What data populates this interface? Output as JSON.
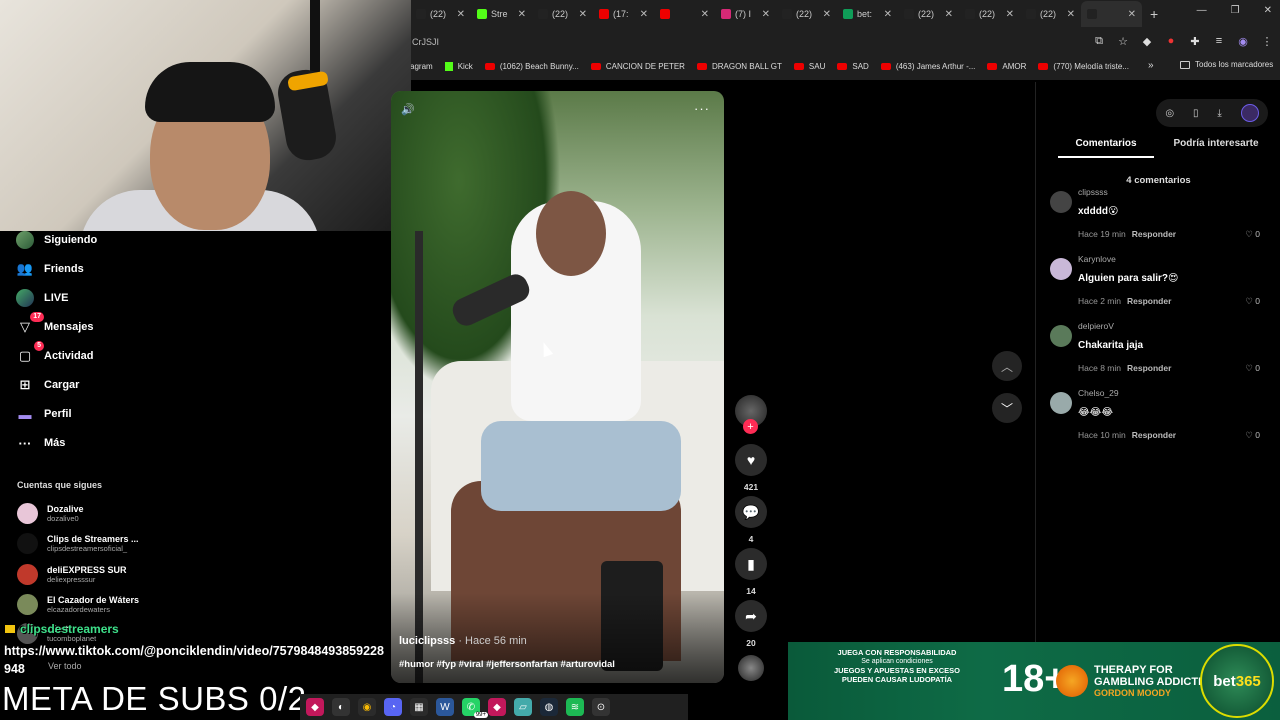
{
  "browser": {
    "tabs": [
      {
        "label": "(22)",
        "icon": "tiktok-icon",
        "color": "#222"
      },
      {
        "label": "Stre",
        "icon": "kick-icon",
        "color": "#53fc18"
      },
      {
        "label": "(22)",
        "icon": "tiktok-icon",
        "color": "#222"
      },
      {
        "label": "(17:",
        "icon": "youtube-icon",
        "color": "#e00"
      },
      {
        "label": "",
        "icon": "youtube-icon",
        "color": "#e00"
      },
      {
        "label": "(7) I",
        "icon": "instagram-icon",
        "color": "#d62976"
      },
      {
        "label": "(22)",
        "icon": "tiktok-icon",
        "color": "#222"
      },
      {
        "label": "bet:",
        "icon": "sheets-icon",
        "color": "#0f9d58"
      },
      {
        "label": "(22)",
        "icon": "tiktok-icon",
        "color": "#222"
      },
      {
        "label": "(22)",
        "icon": "tiktok-icon",
        "color": "#222"
      },
      {
        "label": "(22)",
        "icon": "tiktok-icon",
        "color": "#222"
      },
      {
        "label": "",
        "icon": "tiktok-icon",
        "color": "#222",
        "active": true
      }
    ],
    "new_tab": "+",
    "address_fragment": "CrJSJI",
    "bookmarks": [
      {
        "label": "agram",
        "icon": "none"
      },
      {
        "label": "Kick",
        "icon": "kick-icon"
      },
      {
        "label": "(1062) Beach Bunny...",
        "icon": "youtube-icon"
      },
      {
        "label": "CANCION DE PETER",
        "icon": "youtube-icon"
      },
      {
        "label": "DRAGON BALL GT",
        "icon": "youtube-icon"
      },
      {
        "label": "SAU",
        "icon": "youtube-icon"
      },
      {
        "label": "SAD",
        "icon": "youtube-icon"
      },
      {
        "label": "(463) James Arthur -...",
        "icon": "youtube-icon"
      },
      {
        "label": "AMOR",
        "icon": "youtube-icon"
      },
      {
        "label": "(770) Melodía triste...",
        "icon": "youtube-icon"
      }
    ],
    "bookmarks_more": "»",
    "all_bookmarks": "Todos los marcadores"
  },
  "sidebar": {
    "nav": [
      {
        "label": "Siguiendo",
        "icon": "following-avatar-icon",
        "badge": ""
      },
      {
        "label": "Friends",
        "icon": "friends-icon",
        "badge": ""
      },
      {
        "label": "LIVE",
        "icon": "live-icon",
        "badge": ""
      },
      {
        "label": "Mensajes",
        "icon": "messages-icon",
        "badge": "17"
      },
      {
        "label": "Actividad",
        "icon": "activity-icon",
        "badge": "5"
      },
      {
        "label": "Cargar",
        "icon": "upload-icon",
        "badge": ""
      },
      {
        "label": "Perfil",
        "icon": "profile-icon",
        "badge": ""
      },
      {
        "label": "Más",
        "icon": "more-icon",
        "badge": ""
      }
    ],
    "following_title": "Cuentas que sigues",
    "accounts": [
      {
        "name": "Dozalive",
        "handle": "dozalive0",
        "color": "#e8c6d8"
      },
      {
        "name": "Clips de Streamers ...",
        "handle": "clipsdestreamersoficial_",
        "color": "#111"
      },
      {
        "name": "deliEXPRESS SUR",
        "handle": "deliexpresssur",
        "color": "#c0392b"
      },
      {
        "name": "El Cazador de Wáters",
        "handle": "elcazadordewaters",
        "color": "#7a8a5a"
      },
      {
        "name": "...hot",
        "handle": "tucomboplanet",
        "color": "#555"
      }
    ],
    "see_all": "Ver todo"
  },
  "overlay": {
    "chat_user": "clipsdestreamers",
    "chat_url": "https://www.tiktok.com/@ponciklendin/video/7579848493859228948",
    "meta_subs": "META DE SUBS 0/2"
  },
  "video": {
    "author": "luciclipsss",
    "time": " · Hace 56 min",
    "tags": "#humor #fyp #viral #jeffersonfarfan #arturovidal",
    "likes": "421",
    "comments": "4",
    "saves": "14",
    "shares": "20",
    "more": "···"
  },
  "comments_panel": {
    "tab_comments": "Comentarios",
    "tab_interest": "Podría interesarte",
    "count": "4 comentarios",
    "reply_label": "Responder",
    "items": [
      {
        "user": "clipssss",
        "text": "xdddd😮",
        "time": "Hace 19 min",
        "likes": "0",
        "color": "#444"
      },
      {
        "user": "Karynlove",
        "text": "Alguien para salir?😍",
        "time": "Hace 2 min",
        "likes": "0",
        "color": "#c9b8d8"
      },
      {
        "user": "delpieroV",
        "text": "Chakarita jaja",
        "time": "Hace 8 min",
        "likes": "0",
        "color": "#5a7a5a"
      },
      {
        "user": "Chelso_29",
        "text": "😂😂😂",
        "time": "Hace 10 min",
        "likes": "0",
        "color": "#9aa"
      }
    ]
  },
  "ad": {
    "resp_line1": "JUEGA CON RESPONSABILIDAD",
    "resp_line2": "Se aplican condiciones",
    "resp_line3": "JUEGOS Y APUESTAS EN EXCESO",
    "resp_line4": "PUEDEN CAUSAR LUDOPATÍA",
    "age": "18+",
    "therapy_1": "THERAPY FOR",
    "therapy_2": "GAMBLING ADDICTION",
    "therapy_3": "GORDON MOODY",
    "bet_a": "bet",
    "bet_b": "365"
  },
  "taskbar": {
    "whatsapp_badge": "99+"
  }
}
